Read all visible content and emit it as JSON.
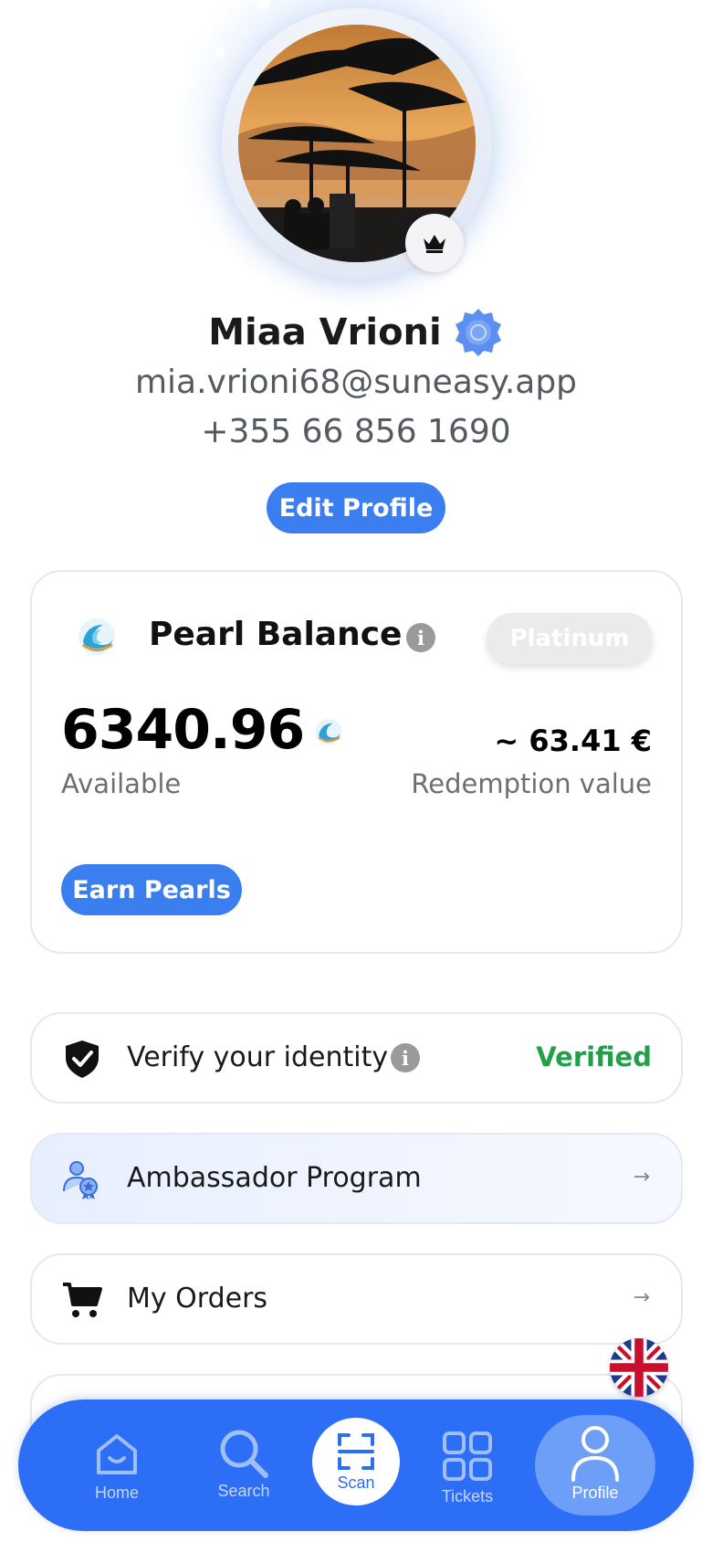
{
  "profile": {
    "name": "Miaa Vrioni",
    "email": "mia.vrioni68@suneasy.app",
    "phone": "+355 66 856 1690",
    "edit_label": "Edit Profile",
    "badge_icon": "crown-icon",
    "seal_icon": "verified-seal-icon"
  },
  "pearl_card": {
    "title": "Pearl Balance",
    "tier": "Platinum",
    "balance": "6340.96",
    "balance_caption": "Available",
    "redemption": "~ 63.41 €",
    "redemption_caption": "Redemption value",
    "earn_label": "Earn Pearls"
  },
  "rows": {
    "verify": {
      "label": "Verify your identity",
      "status": "Verified",
      "icon": "shield-check-icon"
    },
    "ambassador": {
      "label": "Ambassador Program",
      "icon": "ambassador-icon",
      "arrow": "→"
    },
    "orders": {
      "label": "My Orders",
      "icon": "cart-icon",
      "arrow": "→"
    }
  },
  "language": {
    "icon": "uk-flag-icon"
  },
  "nav": {
    "items": [
      {
        "label": "Home",
        "icon": "home-icon"
      },
      {
        "label": "Search",
        "icon": "search-icon"
      },
      {
        "label": "Scan",
        "icon": "scan-icon"
      },
      {
        "label": "Tickets",
        "icon": "tickets-icon"
      },
      {
        "label": "Profile",
        "icon": "profile-icon"
      }
    ],
    "active": "Profile"
  },
  "colors": {
    "accent": "#3b7ef0",
    "nav_bg": "#2c6ef5",
    "verified": "#21a04a"
  }
}
